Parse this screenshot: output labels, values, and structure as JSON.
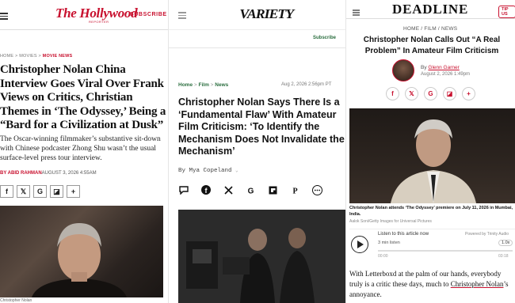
{
  "thr": {
    "logo": "The Hollywood",
    "logo_sub": "REPORTER",
    "subscribe": "SUBSCRIBE",
    "breadcrumbs": [
      "HOME",
      "MOVIES"
    ],
    "breadcrumb_current": "MOVIE NEWS",
    "headline": "Christopher Nolan China Interview Goes Viral Over Frank Views on Critics, Christian Themes in ‘The Odyssey,’ Being a “Bard for a Civilization at Dusk”",
    "dek": "The Oscar-winning filmmaker’s substantive sit-down with Chinese podcaster Zhong Shu wasn’t the usual surface-level press tour interview.",
    "byline": "BY ABID RAHMAN",
    "date": "AUGUST 3, 2026 4:55AM",
    "share": [
      "f",
      "𝕏",
      "G",
      "◪",
      "+"
    ],
    "caption": "Christopher Nolan"
  },
  "variety": {
    "logo": "VARIETY",
    "subscribe": "Subscribe",
    "breadcrumbs": [
      "Home",
      "Film",
      "News"
    ],
    "date": "Aug 2, 2026 2:56pm PT",
    "headline": "Christopher Nolan Says There Is a ‘Fundamental Flaw’ With Amateur Film Criticism: ‘To Identify the Mechanism Does Not Invalidate the Mechanism’",
    "byline": "By Mya Copeland",
    "share_icons": [
      "comment-icon",
      "facebook-icon",
      "x-icon",
      "google-icon",
      "flipboard-icon",
      "pinterest-icon",
      "more-icon"
    ]
  },
  "deadline": {
    "logo": "DEADLINE",
    "tip": "TIP US",
    "breadcrumbs": "HOME / FILM / NEWS",
    "headline": "Christopher Nolan Calls Out “A Real Problem” In Amateur Film Criticism",
    "by_prefix": "By",
    "author": "Glenn Garner",
    "date": "August 2, 2026 1:49pm",
    "share": [
      "f",
      "𝕏",
      "G",
      "◪",
      "+"
    ],
    "caption": "Christopher Nolan attends ‘The Odyssey’ premiere on July 11, 2026 in Mumbai, India.",
    "credit": "Aalok Soni/Getty Images for Universal Pictures",
    "player": {
      "listen_label": "Listen to this article now",
      "duration": "3 min listen",
      "powered": "Powered by Trinity Audio",
      "speed": "1.0x",
      "time_start": "00:00",
      "time_end": "03:18",
      "progress": 0
    },
    "body_1": "With Letterboxd at the palm of our hands, everybody truly is a critic these days, much to ",
    "body_link": "Christopher Nolan",
    "body_2": "’s annoyance."
  }
}
